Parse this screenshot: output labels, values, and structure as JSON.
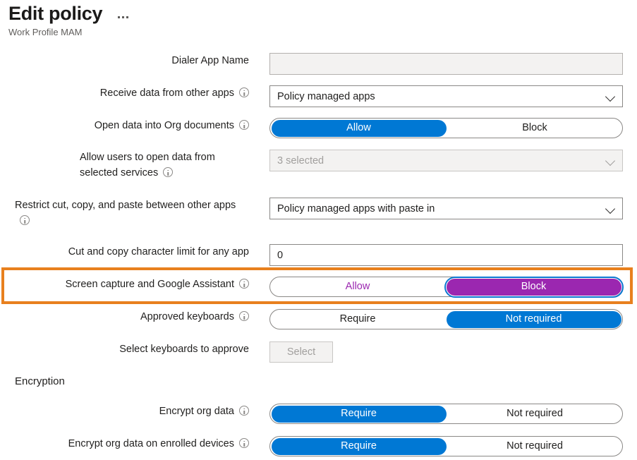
{
  "header": {
    "title": "Edit policy",
    "subtitle": "Work Profile MAM",
    "menu_icon": "ellipsis-icon"
  },
  "colors": {
    "accent_blue": "#0078d4",
    "selected_purple": "#9b27b0",
    "highlight_orange": "#e8801e",
    "focus_ring_blue": "#0b77d1",
    "disabled_bg": "#f3f2f1",
    "disabled_text": "#a19f9d",
    "border_grey": "#8a8886",
    "subtitle_grey": "#605e5c"
  },
  "sections": [
    {
      "id": "encryption_heading",
      "label": "Encryption"
    }
  ],
  "rows": [
    {
      "id": "dialer_app_name",
      "label": "Dialer App Name",
      "has_info": false,
      "indent": 0,
      "control": "textbox",
      "value": "",
      "disabled": true
    },
    {
      "id": "receive_data_from_other_apps",
      "label": "Receive data from other apps",
      "has_info": true,
      "indent": 0,
      "control": "dropdown",
      "value": "Policy managed apps",
      "disabled": false
    },
    {
      "id": "open_data_into_org_documents",
      "label": "Open data into Org documents",
      "has_info": true,
      "indent": 1,
      "control": "segmented",
      "options": [
        "Allow",
        "Block"
      ],
      "selected_index": 0,
      "style": "blue"
    },
    {
      "id": "allow_users_open_data_selected_services",
      "label": "Allow users to open data from selected services",
      "has_info": true,
      "indent": 2,
      "wrapped": true,
      "control": "dropdown",
      "value": "3 selected",
      "disabled": true
    },
    {
      "id": "restrict_cut_copy_paste",
      "label": "Restrict cut, copy, and paste between other apps",
      "has_info": true,
      "indent": 0,
      "wrapped": true,
      "control": "dropdown",
      "value": "Policy managed apps with paste in",
      "disabled": false
    },
    {
      "id": "cut_copy_character_limit",
      "label": "Cut and copy character limit for any app",
      "has_info": false,
      "indent": 1,
      "control": "textbox",
      "value": "0",
      "disabled": false
    },
    {
      "id": "screen_capture_google_assistant",
      "label": "Screen capture and Google Assistant",
      "has_info": true,
      "indent": 0,
      "control": "segmented",
      "options": [
        "Allow",
        "Block"
      ],
      "selected_index": 1,
      "style": "purple",
      "highlighted": true
    },
    {
      "id": "approved_keyboards",
      "label": "Approved keyboards",
      "has_info": true,
      "indent": 0,
      "control": "segmented",
      "options": [
        "Require",
        "Not required"
      ],
      "selected_index": 1,
      "style": "blue"
    },
    {
      "id": "select_keyboards_to_approve",
      "label": "Select keyboards to approve",
      "has_info": false,
      "indent": 1,
      "control": "button",
      "value": "Select",
      "disabled": true
    },
    {
      "id": "encrypt_org_data",
      "label": "Encrypt org data",
      "has_info": true,
      "indent": 0,
      "control": "segmented",
      "options": [
        "Require",
        "Not required"
      ],
      "selected_index": 0,
      "style": "blue"
    },
    {
      "id": "encrypt_org_data_enrolled_devices",
      "label": "Encrypt org data on enrolled devices",
      "has_info": true,
      "indent": 1,
      "control": "segmented",
      "options": [
        "Require",
        "Not required"
      ],
      "selected_index": 0,
      "style": "blue"
    }
  ]
}
